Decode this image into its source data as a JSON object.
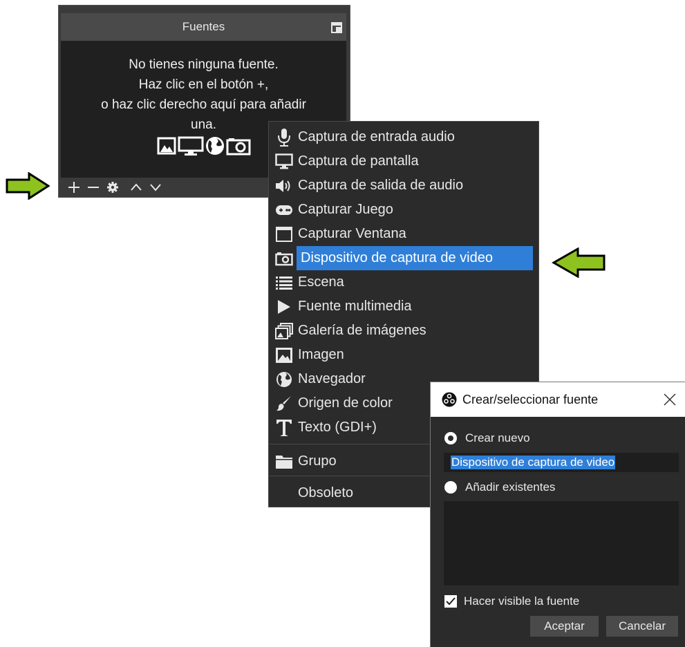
{
  "sources_panel": {
    "title": "Fuentes",
    "empty_message": [
      "No tienes ninguna fuente.",
      "Haz clic en el botón +,",
      "o haz clic derecho aquí para añadir",
      "una."
    ],
    "toolbar": {
      "add": "+",
      "remove": "—",
      "settings": "gear-icon",
      "up": "chevron-up-icon",
      "down": "chevron-down-icon"
    }
  },
  "context_menu": {
    "items": [
      {
        "label": "Captura de entrada audio",
        "icon": "microphone-icon"
      },
      {
        "label": "Captura de pantalla",
        "icon": "monitor-icon"
      },
      {
        "label": "Captura de salida de audio",
        "icon": "speaker-icon"
      },
      {
        "label": "Capturar Juego",
        "icon": "gamepad-icon"
      },
      {
        "label": "Capturar Ventana",
        "icon": "window-icon"
      },
      {
        "label": "Dispositivo de captura de video",
        "icon": "camera-icon",
        "selected": true
      },
      {
        "label": "Escena",
        "icon": "list-icon"
      },
      {
        "label": "Fuente multimedia",
        "icon": "play-icon"
      },
      {
        "label": "Galería de imágenes",
        "icon": "gallery-icon"
      },
      {
        "label": "Imagen",
        "icon": "image-icon"
      },
      {
        "label": "Navegador",
        "icon": "globe-icon"
      },
      {
        "label": "Origen de color",
        "icon": "brush-icon"
      },
      {
        "label": "Texto (GDI+)",
        "icon": "text-icon"
      },
      {
        "label": "Grupo",
        "icon": "folder-icon"
      },
      {
        "label": "Obsoleto",
        "icon": ""
      }
    ]
  },
  "dialog": {
    "title": "Crear/seleccionar fuente",
    "create_new_label": "Crear nuevo",
    "name_value": "Dispositivo de captura de video",
    "add_existing_label": "Añadir existentes",
    "visible_label": "Hacer visible la fuente",
    "ok_label": "Aceptar",
    "cancel_label": "Cancelar"
  },
  "colors": {
    "arrow_fill": "#8dc21f",
    "selection": "#2f7fd8",
    "panel_bg": "#202020",
    "menu_bg": "#2b2b2b"
  }
}
